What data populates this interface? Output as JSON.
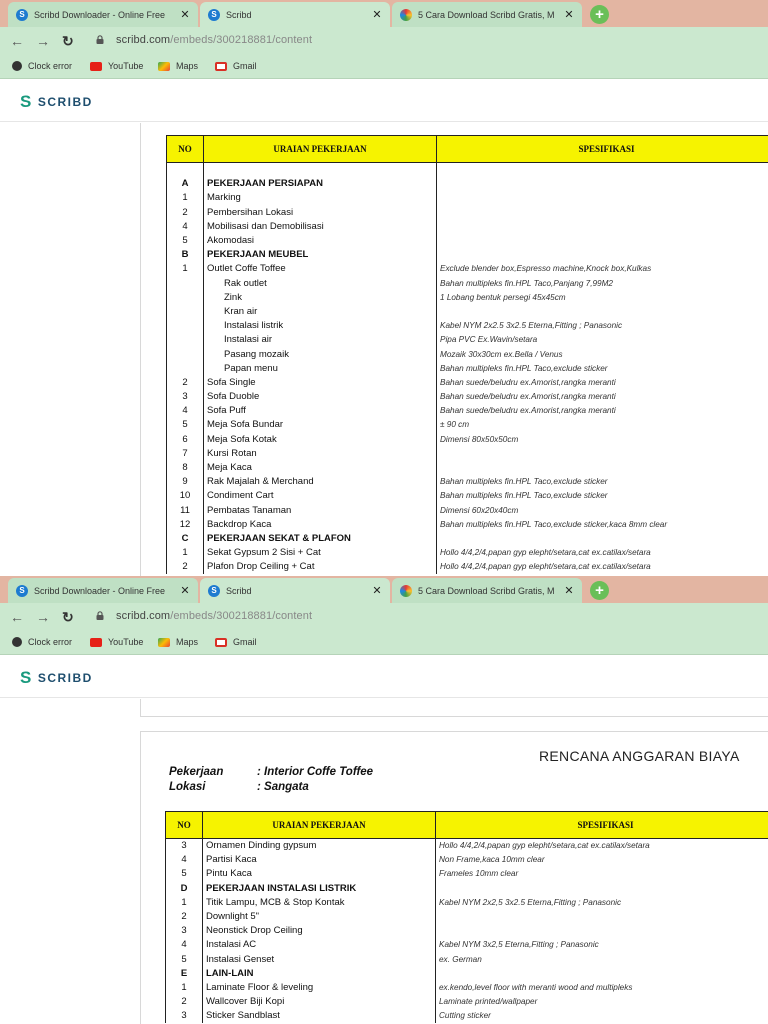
{
  "browser": {
    "tabs": [
      {
        "title": "Scribd Downloader - Online Free",
        "state": "inactive"
      },
      {
        "title": "Scribd",
        "state": "active"
      },
      {
        "title": "5 Cara Download Scribd Gratis, M",
        "state": "inactive"
      }
    ],
    "new_tab": "+",
    "url_host": "scribd.com",
    "url_path": "/embeds/300218881/content",
    "bookmarks": [
      "Clock error",
      "YouTube",
      "Maps",
      "Gmail"
    ]
  },
  "scribd": {
    "brand": "SCRIBD"
  },
  "colors": {
    "header_yellow": "#f6f300",
    "tab_green": "#cbe8cf",
    "tabbar_bg": "#e3b5a2",
    "scribd_teal": "#1a9a7e"
  },
  "table": {
    "headers": [
      "NO",
      "URAIAN PEKERJAAN",
      "SPESIFIKASI"
    ]
  },
  "document2": {
    "title": "RENCANA ANGGARAN BIAYA",
    "pekerjaan_label": "Pekerjaan",
    "pekerjaan_value": ":  Interior Coffe Toffee",
    "lokasi_label": "Lokasi",
    "lokasi_value": ":  Sangata"
  },
  "page1_rows": [
    {
      "no": "",
      "desc": "",
      "spec": ""
    },
    {
      "no": "A",
      "desc": "PEKERJAAN PERSIAPAN",
      "spec": "",
      "bold": true
    },
    {
      "no": "1",
      "desc": "Marking",
      "spec": ""
    },
    {
      "no": "2",
      "desc": "Pembersihan Lokasi",
      "spec": ""
    },
    {
      "no": "4",
      "desc": "Mobilisasi dan Demobilisasi",
      "spec": ""
    },
    {
      "no": "5",
      "desc": "Akomodasi",
      "spec": ""
    },
    {
      "no": "B",
      "desc": "PEKERJAAN MEUBEL",
      "spec": "",
      "bold": true
    },
    {
      "no": "1",
      "desc": "Outlet Coffe Toffee",
      "spec": "Exclude blender box,Espresso machine,Knock box,Kulkas"
    },
    {
      "no": "",
      "desc": "Rak outlet",
      "spec": "Bahan multipleks fin.HPL Taco,Panjang 7,99M2",
      "sub": true
    },
    {
      "no": "",
      "desc": "Zink",
      "spec": "1 Lobang bentuk persegi 45x45cm",
      "sub": true
    },
    {
      "no": "",
      "desc": "Kran air",
      "spec": "",
      "sub": true
    },
    {
      "no": "",
      "desc": "Instalasi listrik",
      "spec": "Kabel NYM 2x2.5 3x2.5 Eterna,Fitting ; Panasonic",
      "sub": true
    },
    {
      "no": "",
      "desc": "Instalasi air",
      "spec": "Pipa PVC Ex.Wavin/setara",
      "sub": true
    },
    {
      "no": "",
      "desc": "Pasang mozaik",
      "spec": "Mozaik 30x30cm ex.Bella / Venus",
      "sub": true
    },
    {
      "no": "",
      "desc": "Papan menu",
      "spec": "Bahan multipleks fin.HPL Taco,exclude sticker",
      "sub": true
    },
    {
      "no": "2",
      "desc": "Sofa Single",
      "spec": "Bahan suede/beludru ex.Amorist,rangka meranti"
    },
    {
      "no": "3",
      "desc": "Sofa Duoble",
      "spec": "Bahan suede/beludru ex.Amorist,rangka meranti"
    },
    {
      "no": "4",
      "desc": "Sofa Puff",
      "spec": "Bahan suede/beludru ex.Amorist,rangka meranti"
    },
    {
      "no": "5",
      "desc": "Meja Sofa Bundar",
      "spec": "± 90 cm"
    },
    {
      "no": "6",
      "desc": "Meja Sofa Kotak",
      "spec": "Dimensi 80x50x50cm"
    },
    {
      "no": "7",
      "desc": "Kursi Rotan",
      "spec": ""
    },
    {
      "no": "8",
      "desc": "Meja Kaca",
      "spec": ""
    },
    {
      "no": "9",
      "desc": "Rak Majalah & Merchand",
      "spec": "Bahan multipleks fin.HPL Taco,exclude sticker"
    },
    {
      "no": "10",
      "desc": "Condiment Cart",
      "spec": "Bahan multipleks fin.HPL Taco,exclude sticker"
    },
    {
      "no": "11",
      "desc": "Pembatas Tanaman",
      "spec": "Dimensi 60x20x40cm"
    },
    {
      "no": "12",
      "desc": "Backdrop Kaca",
      "spec": "Bahan multipleks fin.HPL Taco,exclude sticker,kaca 8mm clear"
    },
    {
      "no": "C",
      "desc": "PEKERJAAN SEKAT & PLAFON",
      "spec": "",
      "bold": true
    },
    {
      "no": "1",
      "desc": "Sekat Gypsum 2 Sisi + Cat",
      "spec": "Hollo 4/4,2/4,papan gyp elepht/setara,cat ex.catilax/setara"
    },
    {
      "no": "2",
      "desc": "Plafon Drop Ceiling + Cat",
      "spec": "Hollo 4/4,2/4,papan gyp elepht/setara,cat ex.catilax/setara"
    }
  ],
  "page2_rows": [
    {
      "no": "3",
      "desc": "Ornamen Dinding gypsum",
      "spec": "Hollo 4/4,2/4,papan gyp elepht/setara,cat ex.catilax/setara"
    },
    {
      "no": "4",
      "desc": "Partisi Kaca",
      "spec": "Non Frame,kaca 10mm clear"
    },
    {
      "no": "5",
      "desc": "Pintu Kaca",
      "spec": "Frameles 10mm clear"
    },
    {
      "no": "D",
      "desc": "PEKERJAAN INSTALASI LISTRIK",
      "spec": "",
      "bold": true
    },
    {
      "no": "1",
      "desc": "Titik Lampu, MCB & Stop Kontak",
      "spec": "Kabel NYM 2x2,5 3x2.5 Eterna,Fitting ; Panasonic"
    },
    {
      "no": "2",
      "desc": "Downlight 5\"",
      "spec": ""
    },
    {
      "no": "3",
      "desc": "Neonstick Drop Ceiling",
      "spec": ""
    },
    {
      "no": "4",
      "desc": "Instalasi AC",
      "spec": "Kabel NYM 3x2,5 Eterna,Fitting ; Panasonic"
    },
    {
      "no": "5",
      "desc": "Instalasi Genset",
      "spec": "ex. German"
    },
    {
      "no": "E",
      "desc": "LAIN-LAIN",
      "spec": "",
      "bold": true
    },
    {
      "no": "1",
      "desc": "Laminate Floor & leveling",
      "spec": "ex.kendo,level floor with meranti wood and multipleks"
    },
    {
      "no": "2",
      "desc": "Wallcover Biji Kopi",
      "spec": "Laminate printed/wallpaper"
    },
    {
      "no": "3",
      "desc": "Sticker Sandblast",
      "spec": "Cutting sticker"
    }
  ]
}
